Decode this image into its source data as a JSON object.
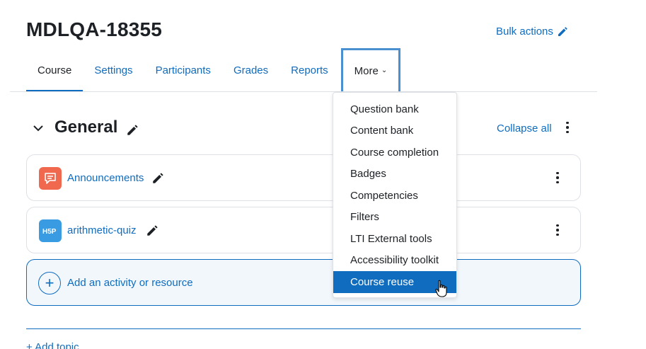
{
  "header": {
    "title": "MDLQA-18355",
    "bulk_actions": "Bulk actions"
  },
  "nav": {
    "tabs": [
      {
        "label": "Course"
      },
      {
        "label": "Settings"
      },
      {
        "label": "Participants"
      },
      {
        "label": "Grades"
      },
      {
        "label": "Reports"
      },
      {
        "label": "More"
      }
    ],
    "active": "Course"
  },
  "more_menu": {
    "items": [
      {
        "label": "Question bank"
      },
      {
        "label": "Content bank"
      },
      {
        "label": "Course completion"
      },
      {
        "label": "Badges"
      },
      {
        "label": "Competencies"
      },
      {
        "label": "Filters"
      },
      {
        "label": "LTI External tools"
      },
      {
        "label": "Accessibility toolkit"
      },
      {
        "label": "Course reuse"
      }
    ],
    "highlighted": "Course reuse"
  },
  "section": {
    "title": "General",
    "collapse_all": "Collapse all"
  },
  "activities": [
    {
      "name": "Announcements",
      "icon": "forum-icon",
      "icon_color": "#f0684e"
    },
    {
      "name": "arithmetic-quiz",
      "icon": "h5p-icon",
      "icon_color": "#399be2"
    }
  ],
  "add_activity": {
    "label": "Add an activity or resource"
  },
  "add_topic": {
    "label": "+ Add topic"
  },
  "colors": {
    "link": "#0f6cbf",
    "text": "#1d2125",
    "selected_bg": "#0f6cbf"
  }
}
